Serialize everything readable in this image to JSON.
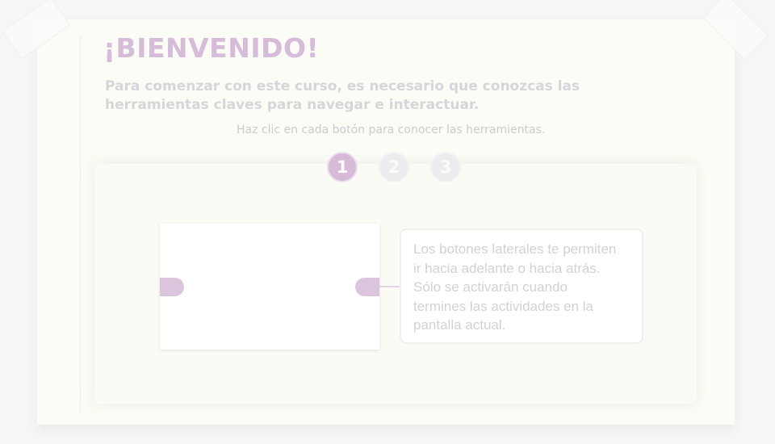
{
  "header": {
    "title": "¡BIENVENIDO!",
    "intro_line_1": "Para comenzar con este curso, es necesario que conozcas las",
    "intro_line_2": "herramientas claves para navegar e interactuar.",
    "instruction": "Haz clic en cada botón para conocer las herramientas."
  },
  "steps": [
    {
      "label": "1",
      "active": true
    },
    {
      "label": "2",
      "active": false
    },
    {
      "label": "3",
      "active": false
    }
  ],
  "callout": {
    "lines": [
      "Los botones laterales te permiten",
      "ir hacia adelante o hacia atrás.",
      "Sólo se activarán cuando",
      "termines las actividades en la",
      "pantalla actual."
    ]
  },
  "colors": {
    "accent": "#d6bad8",
    "inactive_step": "#ececef",
    "muted_text": "#d4d6da"
  },
  "icons": {
    "prev": "left-arrow-tab-icon",
    "next": "right-arrow-tab-icon"
  }
}
